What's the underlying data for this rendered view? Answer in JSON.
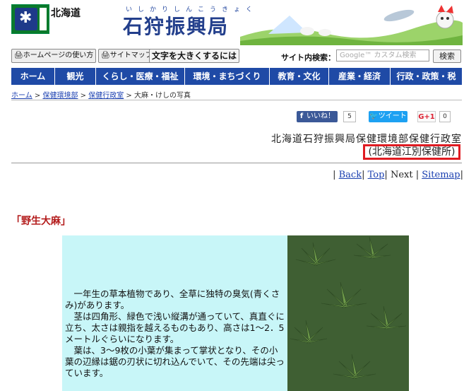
{
  "header": {
    "prefecture": "北海道",
    "ruby": "いしかりしんこうきょく",
    "title": "石狩振興局"
  },
  "toolbar": {
    "howto": "ホームページの使い方",
    "sitemap": "サイトマップ",
    "textsize": "文字を大きくするには",
    "search_label": "サイト内検索：",
    "search_placeholder": "Google™ カスタム検索",
    "search_button": "検索"
  },
  "nav": [
    "ホーム",
    "観光",
    "くらし・医療・福祉",
    "環境・まちづくり",
    "教育・文化",
    "産業・経済",
    "行政・政策・税"
  ],
  "breadcrumb": {
    "home": "ホーム",
    "sep": ">",
    "dept": "保健環境部",
    "section": "保健行政室",
    "current": "大麻・けしの写真"
  },
  "social": {
    "like": "いいね！",
    "like_count": "5",
    "tweet": "ツイート",
    "gplus": "G+1",
    "gplus_count": "0"
  },
  "office": {
    "line1": "北海道石狩振興局保健環境部保健行政室",
    "line2": "(北海道江別保健所)"
  },
  "pager": {
    "back": "Back",
    "top": "Top",
    "next": "Next",
    "sitemap": "Sitemap"
  },
  "section_title": "「野生大麻」",
  "content": {
    "p1": "一年生の草本植物であり、全草に独特の臭気(青くさみ)があります。",
    "p2": "茎は四角形、緑色で浅い縦溝が通っていて、真直ぐに立ち、太さは親指を越えるものもあり、高さは1～2．5メートルぐらいになります。",
    "p3": "葉は、3～9枚の小葉が集まって掌状となり、その小葉の辺縁は鋸の刃状に切れ込んでいて、その先端は尖っています。"
  },
  "colors": {
    "nav_bg": "#1f4aa6",
    "highlight_border": "#e01b22",
    "section_title": "#b31b1b",
    "content_bg": "#c8f6f8"
  }
}
